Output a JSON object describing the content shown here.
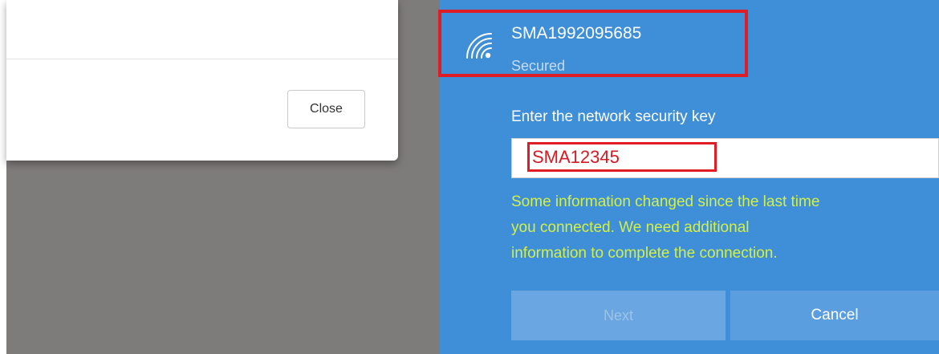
{
  "dialog": {
    "close_label": "Close"
  },
  "wifi": {
    "network_name": "SMA1992095685",
    "network_status": "Secured",
    "icon": "wifi-secured-icon",
    "key_prompt": "Enter the network security key",
    "key_value": "SMA12345",
    "info_message": "Some information changed since the last time\nyou connected. We need additional\ninformation to complete the connection.",
    "next_label": "Next",
    "cancel_label": "Cancel"
  },
  "colors": {
    "flyout_bg": "#3f8ed8",
    "highlight_outline": "#e01c24",
    "warning_text": "#d2f047"
  }
}
